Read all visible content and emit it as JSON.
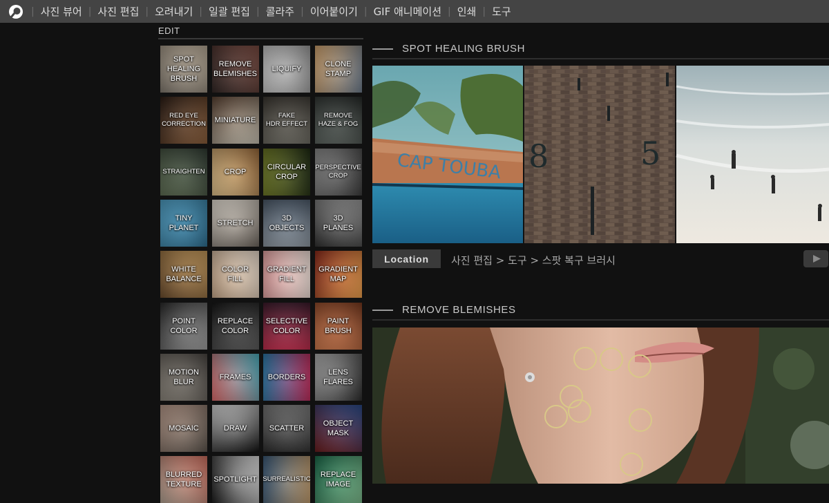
{
  "nav": {
    "items": [
      "사진 뷰어",
      "사진 편집",
      "오려내기",
      "일괄 편집",
      "콜라주",
      "이어붙이기",
      "GIF 애니메이션",
      "인쇄",
      "도구"
    ]
  },
  "left_panel": {
    "title": "EDIT"
  },
  "tools": [
    {
      "label": "SPOT\nHEALING\nBRUSH",
      "icon": "spot-healing-thumb"
    },
    {
      "label": "REMOVE\nBLEMISHES",
      "icon": "remove-blemishes-thumb"
    },
    {
      "label": "LIQUIFY",
      "icon": "liquify-thumb"
    },
    {
      "label": "CLONE\nSTAMP",
      "icon": "clone-stamp-thumb"
    },
    {
      "label": "RED EYE\nCORRECTION",
      "icon": "red-eye-thumb",
      "small": true
    },
    {
      "label": "MINIATURE",
      "icon": "miniature-thumb"
    },
    {
      "label": "FAKE\nHDR EFFECT",
      "icon": "hdr-thumb",
      "small": true
    },
    {
      "label": "REMOVE\nHAZE & FOG",
      "icon": "haze-thumb",
      "small": true
    },
    {
      "label": "STRAIGHTEN",
      "icon": "straighten-thumb",
      "small": true
    },
    {
      "label": "CROP",
      "icon": "crop-thumb"
    },
    {
      "label": "CIRCULAR\nCROP",
      "icon": "circular-crop-thumb"
    },
    {
      "label": "PERSPECTIVE\nCROP",
      "icon": "perspective-crop-thumb",
      "small": true
    },
    {
      "label": "TINY\nPLANET",
      "icon": "tiny-planet-thumb"
    },
    {
      "label": "STRETCH",
      "icon": "stretch-thumb"
    },
    {
      "label": "3D\nOBJECTS",
      "icon": "3d-objects-thumb"
    },
    {
      "label": "3D\nPLANES",
      "icon": "3d-planes-thumb"
    },
    {
      "label": "WHITE\nBALANCE",
      "icon": "white-balance-thumb"
    },
    {
      "label": "COLOR\nFILL",
      "icon": "color-fill-thumb"
    },
    {
      "label": "GRADIENT\nFILL",
      "icon": "gradient-fill-thumb"
    },
    {
      "label": "GRADIENT\nMAP",
      "icon": "gradient-map-thumb"
    },
    {
      "label": "POINT\nCOLOR",
      "icon": "point-color-thumb"
    },
    {
      "label": "REPLACE\nCOLOR",
      "icon": "replace-color-thumb"
    },
    {
      "label": "SELECTIVE\nCOLOR",
      "icon": "selective-color-thumb"
    },
    {
      "label": "PAINT\nBRUSH",
      "icon": "paint-brush-thumb"
    },
    {
      "label": "MOTION\nBLUR",
      "icon": "motion-blur-thumb"
    },
    {
      "label": "FRAMES",
      "icon": "frames-thumb"
    },
    {
      "label": "BORDERS",
      "icon": "borders-thumb"
    },
    {
      "label": "LENS\nFLARES",
      "icon": "lens-flares-thumb"
    },
    {
      "label": "MOSAIC",
      "icon": "mosaic-thumb"
    },
    {
      "label": "DRAW",
      "icon": "draw-thumb"
    },
    {
      "label": "SCATTER",
      "icon": "scatter-thumb"
    },
    {
      "label": "OBJECT\nMASK",
      "icon": "object-mask-thumb"
    },
    {
      "label": "BLURRED\nTEXTURE",
      "icon": "blurred-texture-thumb"
    },
    {
      "label": "SPOTLIGHT",
      "icon": "spotlight-thumb"
    },
    {
      "label": "SURREALISTIC",
      "icon": "surrealistic-thumb",
      "small": true
    },
    {
      "label": "REPLACE\nIMAGE",
      "icon": "replace-image-thumb"
    }
  ],
  "sections": {
    "spot_healing": {
      "title": "SPOT HEALING BRUSH",
      "photo_text": [
        "CAP TOUBA",
        "8",
        "5"
      ],
      "location_label": "Location",
      "location_path": "사진 편집 > 도구 > 스팟 복구 브러시"
    },
    "remove_blemishes": {
      "title": "REMOVE BLEMISHES"
    }
  },
  "colors": {
    "topbar": "#444444",
    "background": "#111111",
    "tag": "#3a3a3a",
    "blemish_ring": "#d9c888"
  }
}
